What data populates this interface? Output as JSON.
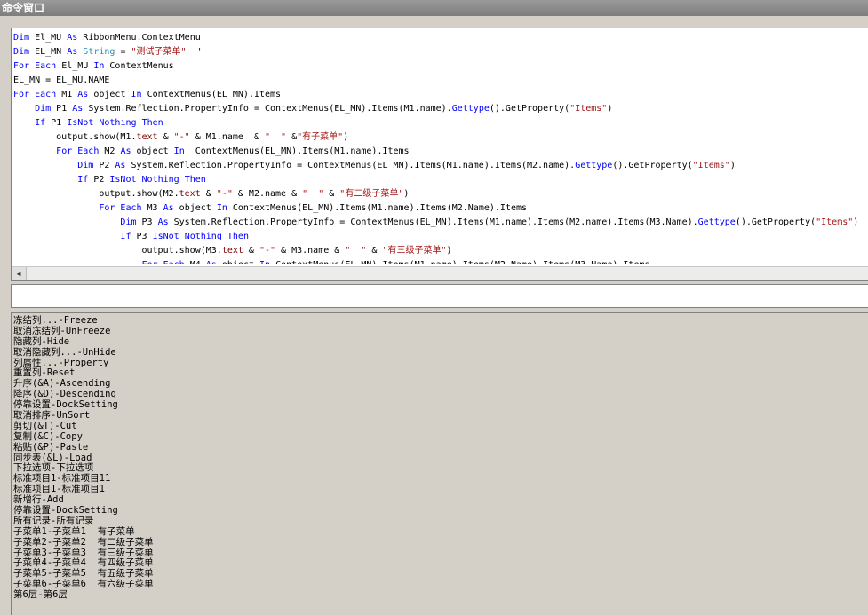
{
  "window": {
    "title": "命令窗口"
  },
  "code_lines": [
    [
      {
        "t": "Dim",
        "c": "kw"
      },
      {
        "t": " El_MU "
      },
      {
        "t": "As",
        "c": "kw"
      },
      {
        "t": " RibbonMenu.ContextMenu"
      }
    ],
    [
      {
        "t": "Dim",
        "c": "kw"
      },
      {
        "t": " EL_MN "
      },
      {
        "t": "As",
        "c": "kw"
      },
      {
        "t": " "
      },
      {
        "t": "String",
        "c": "ty"
      },
      {
        "t": " = "
      },
      {
        "t": "\"测试子菜单\"",
        "c": "str"
      },
      {
        "t": "  '"
      }
    ],
    [
      {
        "t": "For",
        "c": "kw"
      },
      {
        "t": " "
      },
      {
        "t": "Each",
        "c": "kw"
      },
      {
        "t": " El_MU "
      },
      {
        "t": "In",
        "c": "kw"
      },
      {
        "t": " ContextMenus"
      }
    ],
    [
      {
        "t": "EL_MN = EL_MU.NAME"
      }
    ],
    [
      {
        "t": "For",
        "c": "kw"
      },
      {
        "t": " "
      },
      {
        "t": "Each",
        "c": "kw"
      },
      {
        "t": " M1 "
      },
      {
        "t": "As",
        "c": "kw"
      },
      {
        "t": " object "
      },
      {
        "t": "In",
        "c": "kw"
      },
      {
        "t": " ContextMenus(EL_MN).Items"
      }
    ],
    [
      {
        "t": "    "
      },
      {
        "t": "Dim",
        "c": "kw"
      },
      {
        "t": " P1 "
      },
      {
        "t": "As",
        "c": "kw"
      },
      {
        "t": " System.Reflection.PropertyInfo = ContextMenus(EL_MN).Items(M1.name)."
      },
      {
        "t": "Gettype",
        "c": "kw"
      },
      {
        "t": "().GetProperty("
      },
      {
        "t": "\"Items\"",
        "c": "str"
      },
      {
        "t": ")"
      }
    ],
    [
      {
        "t": "    "
      },
      {
        "t": "If",
        "c": "kw"
      },
      {
        "t": " P1 "
      },
      {
        "t": "IsNot",
        "c": "kw"
      },
      {
        "t": " "
      },
      {
        "t": "Nothing",
        "c": "kw"
      },
      {
        "t": " "
      },
      {
        "t": "Then",
        "c": "kw"
      }
    ],
    [
      {
        "t": "        output.show(M1."
      },
      {
        "t": "text",
        "c": "prop"
      },
      {
        "t": " & "
      },
      {
        "t": "\"-\"",
        "c": "str"
      },
      {
        "t": " & M1.name  & "
      },
      {
        "t": "\"  \"",
        "c": "str"
      },
      {
        "t": " &"
      },
      {
        "t": "\"有子菜单\"",
        "c": "str"
      },
      {
        "t": ")"
      }
    ],
    [
      {
        "t": "        "
      },
      {
        "t": "For",
        "c": "kw"
      },
      {
        "t": " "
      },
      {
        "t": "Each",
        "c": "kw"
      },
      {
        "t": " M2 "
      },
      {
        "t": "As",
        "c": "kw"
      },
      {
        "t": " object "
      },
      {
        "t": "In",
        "c": "kw"
      },
      {
        "t": "  ContextMenus(EL_MN).Items(M1.name).Items"
      }
    ],
    [
      {
        "t": "            "
      },
      {
        "t": "Dim",
        "c": "kw"
      },
      {
        "t": " P2 "
      },
      {
        "t": "As",
        "c": "kw"
      },
      {
        "t": " System.Reflection.PropertyInfo = ContextMenus(EL_MN).Items(M1.name).Items(M2.name)."
      },
      {
        "t": "Gettype",
        "c": "kw"
      },
      {
        "t": "().GetProperty("
      },
      {
        "t": "\"Items\"",
        "c": "str"
      },
      {
        "t": ")"
      }
    ],
    [
      {
        "t": "            "
      },
      {
        "t": "If",
        "c": "kw"
      },
      {
        "t": " P2 "
      },
      {
        "t": "IsNot",
        "c": "kw"
      },
      {
        "t": " "
      },
      {
        "t": "Nothing",
        "c": "kw"
      },
      {
        "t": " "
      },
      {
        "t": "Then",
        "c": "kw"
      }
    ],
    [
      {
        "t": "                output.show(M2."
      },
      {
        "t": "text",
        "c": "prop"
      },
      {
        "t": " & "
      },
      {
        "t": "\"-\"",
        "c": "str"
      },
      {
        "t": " & M2.name & "
      },
      {
        "t": "\"  \"",
        "c": "str"
      },
      {
        "t": " & "
      },
      {
        "t": "\"有二级子菜单\"",
        "c": "str"
      },
      {
        "t": ")"
      }
    ],
    [
      {
        "t": "                "
      },
      {
        "t": "For",
        "c": "kw"
      },
      {
        "t": " "
      },
      {
        "t": "Each",
        "c": "kw"
      },
      {
        "t": " M3 "
      },
      {
        "t": "As",
        "c": "kw"
      },
      {
        "t": " object "
      },
      {
        "t": "In",
        "c": "kw"
      },
      {
        "t": " ContextMenus(EL_MN).Items(M1.name).Items(M2.Name).Items"
      }
    ],
    [
      {
        "t": "                    "
      },
      {
        "t": "Dim",
        "c": "kw"
      },
      {
        "t": " P3 "
      },
      {
        "t": "As",
        "c": "kw"
      },
      {
        "t": " System.Reflection.PropertyInfo = ContextMenus(EL_MN).Items(M1.name).Items(M2.name).Items(M3.Name)."
      },
      {
        "t": "Gettype",
        "c": "kw"
      },
      {
        "t": "().GetProperty("
      },
      {
        "t": "\"Items\"",
        "c": "str"
      },
      {
        "t": ")"
      }
    ],
    [
      {
        "t": "                    "
      },
      {
        "t": "If",
        "c": "kw"
      },
      {
        "t": " P3 "
      },
      {
        "t": "IsNot",
        "c": "kw"
      },
      {
        "t": " "
      },
      {
        "t": "Nothing",
        "c": "kw"
      },
      {
        "t": " "
      },
      {
        "t": "Then",
        "c": "kw"
      }
    ],
    [
      {
        "t": "                        output.show(M3."
      },
      {
        "t": "text",
        "c": "prop"
      },
      {
        "t": " & "
      },
      {
        "t": "\"-\"",
        "c": "str"
      },
      {
        "t": " & M3.name & "
      },
      {
        "t": "\"  \"",
        "c": "str"
      },
      {
        "t": " & "
      },
      {
        "t": "\"有三级子菜单\"",
        "c": "str"
      },
      {
        "t": ")"
      }
    ],
    [
      {
        "t": "                        "
      },
      {
        "t": "For",
        "c": "kw"
      },
      {
        "t": " "
      },
      {
        "t": "Each",
        "c": "kw"
      },
      {
        "t": " M4 "
      },
      {
        "t": "As",
        "c": "kw"
      },
      {
        "t": " object "
      },
      {
        "t": "In",
        "c": "kw"
      },
      {
        "t": " ContextMenus(EL_MN).Items(M1.name).Items(M2.Name).Items(M3.Name).Items"
      }
    ]
  ],
  "command_input": {
    "value": ""
  },
  "output_lines": [
    "冻结列...-Freeze",
    "取消冻结列-UnFreeze",
    "隐藏列-Hide",
    "取消隐藏列...-UnHide",
    "列属性...-Property",
    "重置列-Reset",
    "升序(&A)-Ascending",
    "降序(&D)-Descending",
    "停靠设置-DockSetting",
    "取消排序-UnSort",
    "剪切(&T)-Cut",
    "复制(&C)-Copy",
    "粘贴(&P)-Paste",
    "同步表(&L)-Load",
    "下拉选项-下拉选项",
    "标准项目1-标准项目11",
    "标准项目1-标准项目1",
    "新增行-Add",
    "停靠设置-DockSetting",
    "所有记录-所有记录",
    "子菜单1-子菜单1  有子菜单",
    "子菜单2-子菜单2  有二级子菜单",
    "子菜单3-子菜单3  有三级子菜单",
    "子菜单4-子菜单4  有四级子菜单",
    "子菜单5-子菜单5  有五级子菜单",
    "子菜单6-子菜单6  有六级子菜单",
    "第6层-第6层"
  ],
  "colors": {
    "keyword": "#0000ff",
    "string": "#a31515",
    "property": "#800000",
    "type": "#2b91af"
  },
  "icons": {
    "scroll_left": "scroll-left-arrow-icon"
  }
}
